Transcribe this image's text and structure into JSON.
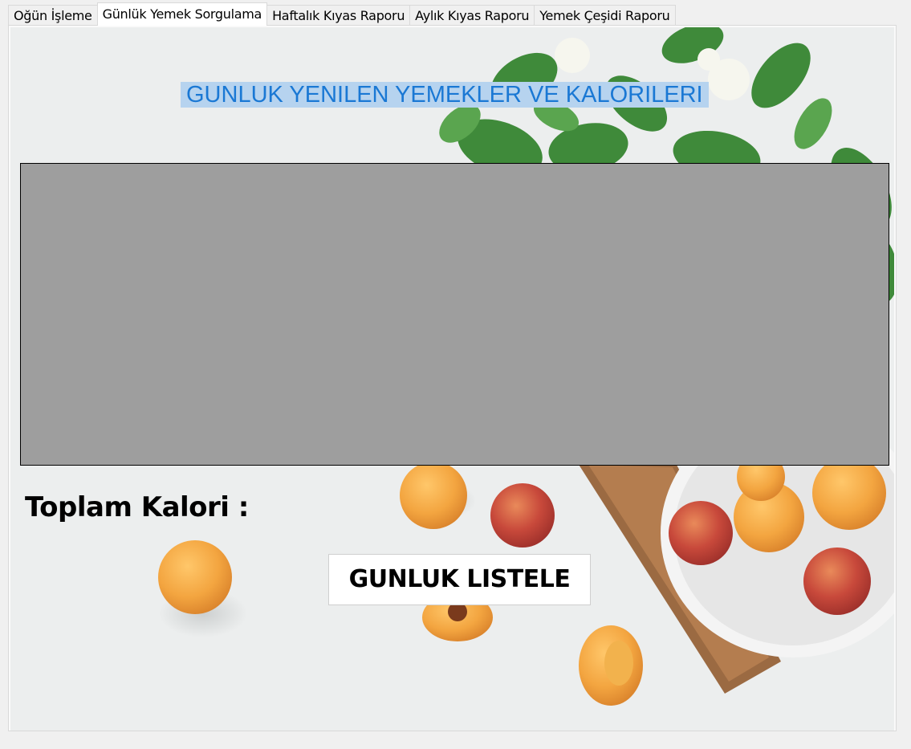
{
  "tabs": [
    {
      "label": "Oğün İşleme"
    },
    {
      "label": "Günlük Yemek Sorgulama"
    },
    {
      "label": "Haftalık Kıyas Raporu"
    },
    {
      "label": "Aylık Kıyas Raporu"
    },
    {
      "label": "Yemek Çeşidi Raporu"
    }
  ],
  "active_tab": "Günlük Yemek Sorgulama",
  "panel": {
    "title": "GUNLUK YENILEN YEMEKLER VE KALORILERI",
    "total_label": "Toplam Kalori :",
    "list_button": "GUNLUK LISTELE"
  },
  "colors": {
    "title_text": "#1a78d4",
    "title_highlight": "#b6d3ef",
    "grid_background": "#9e9e9e"
  }
}
